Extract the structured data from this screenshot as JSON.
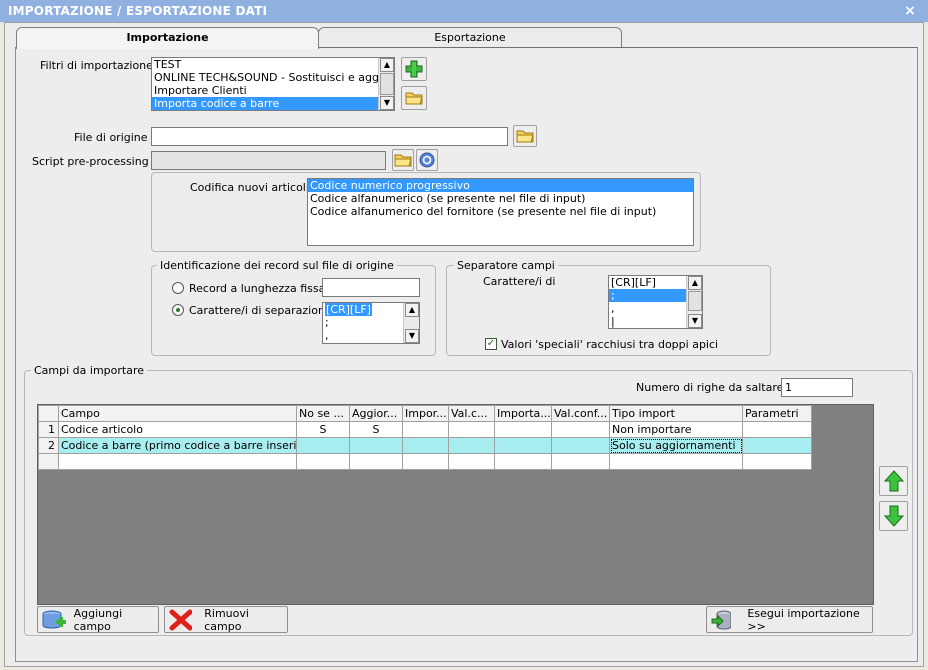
{
  "window": {
    "title": "IMPORTAZIONE / ESPORTAZIONE DATI",
    "close": "×"
  },
  "tabs": [
    {
      "label": "Importazione",
      "active": true
    },
    {
      "label": "Esportazione",
      "active": false
    }
  ],
  "filters": {
    "label": "Filtri di importazione :",
    "items": [
      "TEST",
      "ONLINE TECH&SOUND - Sostituisci e aggiungi c",
      "Importare Clienti",
      "Importa codice a barre"
    ],
    "selected_index": 3
  },
  "source_file": {
    "label": "File di origine :",
    "value": ""
  },
  "script": {
    "label": "Script pre-processing :",
    "value": ""
  },
  "coding": {
    "label": "Codifica nuovi articoli :",
    "options": [
      "Codice numerico progressivo",
      "Codice alfanumerico (se presente nel file di input)",
      "Codice alfanumerico del fornitore (se presente nel file di input)"
    ],
    "selected_index": 0
  },
  "record_id": {
    "title": "Identificazione dei record sul file di origine",
    "fixed_length_label": "Record a lunghezza fissa",
    "separator_label": "Carattere/i di separazione",
    "separator_list": [
      "[CR][LF]",
      ";",
      ","
    ],
    "selected": "separator"
  },
  "field_separator": {
    "title": "Separatore campi",
    "chars_label": "Carattere/i di",
    "list": [
      "[CR][LF]",
      ";",
      ",",
      "|"
    ],
    "quotes_label": "Valori 'speciali' racchiusi tra doppi apici",
    "quotes_checked": true
  },
  "fields": {
    "title": "Campi da importare",
    "skip_rows_label": "Numero di righe da saltare :",
    "skip_rows_value": "1",
    "columns": [
      "Campo",
      "No se ...",
      "Aggior...",
      "Impor...",
      "Val.c...",
      "Importa...",
      "Val.conf...",
      "Tipo import",
      "Parametri"
    ],
    "rows": [
      {
        "n": "1",
        "cells": [
          "Codice articolo",
          "S",
          "S",
          "",
          "",
          "",
          "",
          "Non importare",
          ""
        ]
      },
      {
        "n": "2",
        "cells": [
          "Codice a barre (primo codice a barre inserito)",
          "",
          "",
          "",
          "",
          "",
          "",
          "Solo su aggiornamenti",
          ""
        ]
      },
      {
        "n": "",
        "cells": [
          "",
          "",
          "",
          "",
          "",
          "",
          "",
          "",
          ""
        ]
      }
    ]
  },
  "buttons": {
    "add_field": "Aggiungi campo",
    "remove_field": "Rimuovi campo",
    "run_import": "Esegui importazione >>"
  },
  "colors": {
    "titlebar": "#90b1e0",
    "selection": "#3399ff",
    "row_highlight": "#a8eef0"
  }
}
